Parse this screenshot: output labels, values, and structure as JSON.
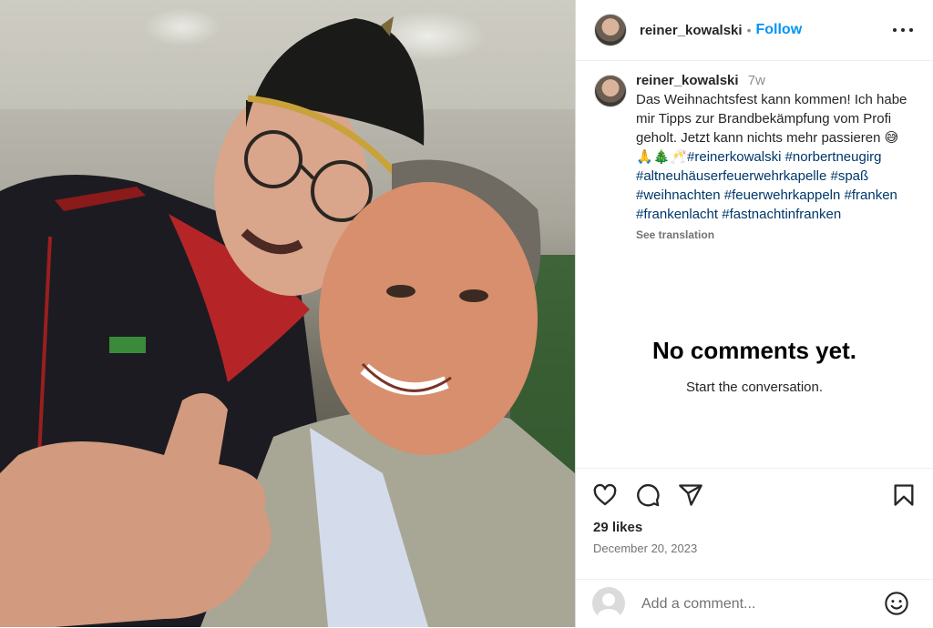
{
  "photo": {
    "alt": ""
  },
  "header": {
    "username": "reiner_kowalski",
    "separator": "•",
    "follow_label": "Follow"
  },
  "caption": {
    "username": "reiner_kowalski",
    "time_ago": "7w",
    "text": "Das Weihnachtsfest kann kommen! Ich habe mir Tipps zur Brandbekämpfung vom Profi geholt. Jetzt kann nichts mehr passieren 😅🙏🎄🥂",
    "hashtags": [
      "#reinerkowalski",
      "#norbertneugirg",
      "#altneuhäuserfeuerwehrkapelle",
      "#spaß",
      "#weihnachten",
      "#feuerwehrkappeln",
      "#franken",
      "#frankenlacht",
      "#fastnachtinfranken"
    ],
    "see_translation": "See translation"
  },
  "comments": {
    "empty_title": "No comments yet.",
    "empty_subtitle": "Start the conversation."
  },
  "actions": {
    "likes": "29 likes",
    "date": "December 20, 2023",
    "icons": [
      "heart-icon",
      "comment-icon",
      "share-icon",
      "bookmark-icon"
    ]
  },
  "comment_box": {
    "placeholder": "Add a comment...",
    "emoji_icon": "smiley-icon"
  }
}
